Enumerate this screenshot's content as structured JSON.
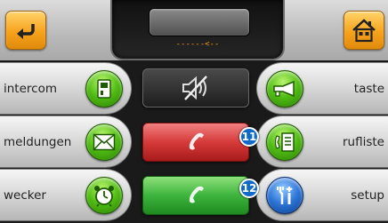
{
  "top": {
    "display_text": "------<--"
  },
  "left": [
    {
      "label": "intercom",
      "icon": "intercom-icon"
    },
    {
      "label": "meldungen",
      "icon": "envelope-icon"
    },
    {
      "label": "wecker",
      "icon": "alarm-clock-icon"
    }
  ],
  "right": [
    {
      "label": "taste",
      "icon": "horn-icon"
    },
    {
      "label": "rufliste",
      "icon": "call-list-icon"
    },
    {
      "label": "setup",
      "icon": "tools-icon"
    }
  ],
  "badges": {
    "hangup": "11",
    "answer": "12"
  },
  "colors": {
    "accent_orange": "#f7a21c",
    "green": "#4fbb12",
    "red": "#d63a3a",
    "blue": "#2c74d6"
  }
}
